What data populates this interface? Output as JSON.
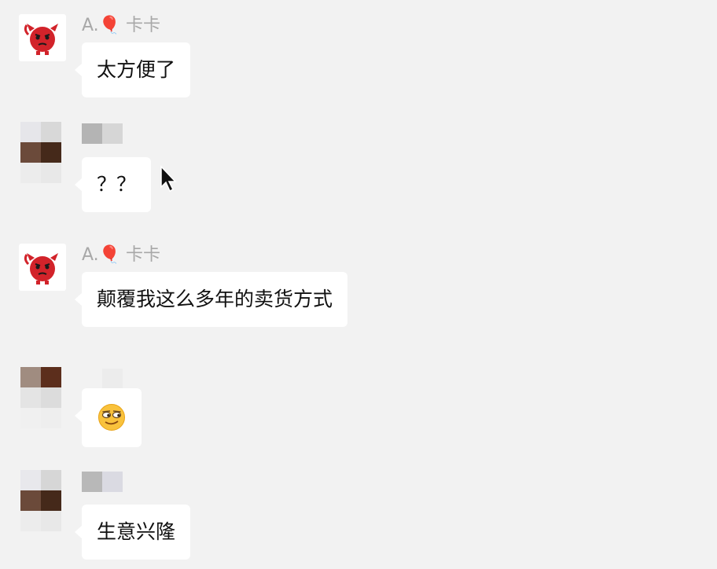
{
  "messages": [
    {
      "sender": "A.🎈 卡卡",
      "text": "太方便了",
      "avatar_icon": "red-devil-avatar"
    },
    {
      "sender": "",
      "text": "？？",
      "avatar_icon": "pixelated-avatar"
    },
    {
      "sender": "A.🎈 卡卡",
      "text": "颠覆我这么多年的卖货方式",
      "avatar_icon": "red-devil-avatar"
    },
    {
      "sender": "",
      "text": "",
      "emoji": "smirk-emoji-icon",
      "avatar_icon": "pixelated-avatar"
    },
    {
      "sender": "",
      "text": "生意兴隆",
      "avatar_icon": "pixelated-avatar"
    }
  ],
  "colors": {
    "background": "#f2f2f2",
    "bubble": "#ffffff",
    "sender_name": "#a8a8a8",
    "message_text": "#111111",
    "devil_red": "#d2232a"
  },
  "cursor_icon": "mouse-pointer-icon"
}
